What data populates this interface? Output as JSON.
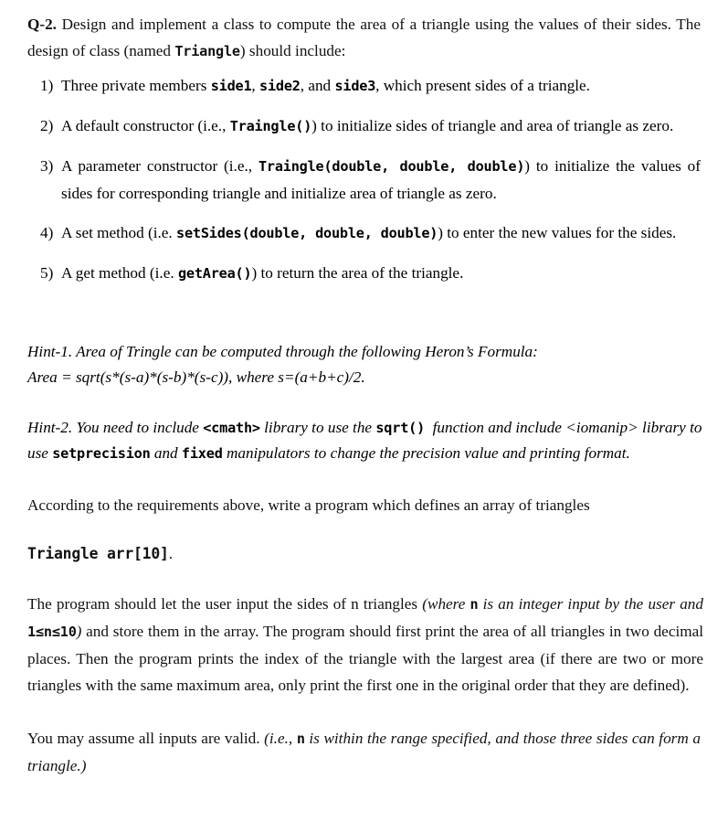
{
  "question": {
    "label": "Q-2.",
    "intro_part1": " Design and implement a class to compute the area of a triangle using the values of their sides. The design of class (named ",
    "intro_code": "Triangle",
    "intro_part2": ") should include:"
  },
  "requirements": [
    {
      "marker": "1)",
      "part1": "Three private members ",
      "code1": "side1",
      "part2": ", ",
      "code2": "side2",
      "part3": ", and ",
      "code3": "side3",
      "part4": ", which present sides of a triangle."
    },
    {
      "marker": "2)",
      "part1": "A default constructor (i.e., ",
      "code1": "Traingle()",
      "part2": ") to initialize sides of triangle and area of triangle as zero."
    },
    {
      "marker": "3)",
      "part1": "A parameter constructor (i.e., ",
      "code1": "Traingle(double, double, double)",
      "part2": ") to initialize the values of sides for corresponding triangle and initialize area of triangle as zero."
    },
    {
      "marker": "4)",
      "part1": "A set method (i.e. ",
      "code1": "setSides(double, double, double)",
      "part2": ") to enter the new values for the sides."
    },
    {
      "marker": "5)",
      "part1": "A get method (i.e. ",
      "code1": "getArea()",
      "part2": ") to return the area of the triangle."
    }
  ],
  "hint1": {
    "line1": "Hint-1. Area of Tringle can be computed through the following Heron’s Formula:",
    "line2": "Area = sqrt(s*(s-a)*(s-b)*(s-c)), where s=(a+b+c)/2."
  },
  "hint2": {
    "part1": "Hint-2. You need to include ",
    "code1": "<cmath>",
    "part2": " library to use the ",
    "code2": "sqrt()",
    "part3": " function and include <iomanip> library to use ",
    "code3": "setprecision",
    "part4": " and ",
    "code4": "fixed",
    "part5": " manipulators to change the precision value and printing format."
  },
  "paragraphs": {
    "according": "According to the requirements above, write a program which defines an array of triangles",
    "array_decl_code": "Triangle arr[10]",
    "array_decl_period": ".",
    "program_part1": "The program should let the user input the sides of n triangles ",
    "program_italic1": "(where ",
    "program_code1": "n",
    "program_italic2": " is an integer input by the user and ",
    "program_code2": "1≤n≤10",
    "program_italic3": ")",
    "program_part2": " and store them in the array. The program should first print the area of all triangles in two decimal places. Then the program prints the index of the triangle with the largest area (if there are two or more triangles with the same maximum area, only print the first one in the original order that they are defined).",
    "assume_part1": "You may assume all inputs are valid. ",
    "assume_italic1": "(i.e., ",
    "assume_code1": "n",
    "assume_italic2": " is within the range specified, and those three sides can form a triangle.)"
  }
}
